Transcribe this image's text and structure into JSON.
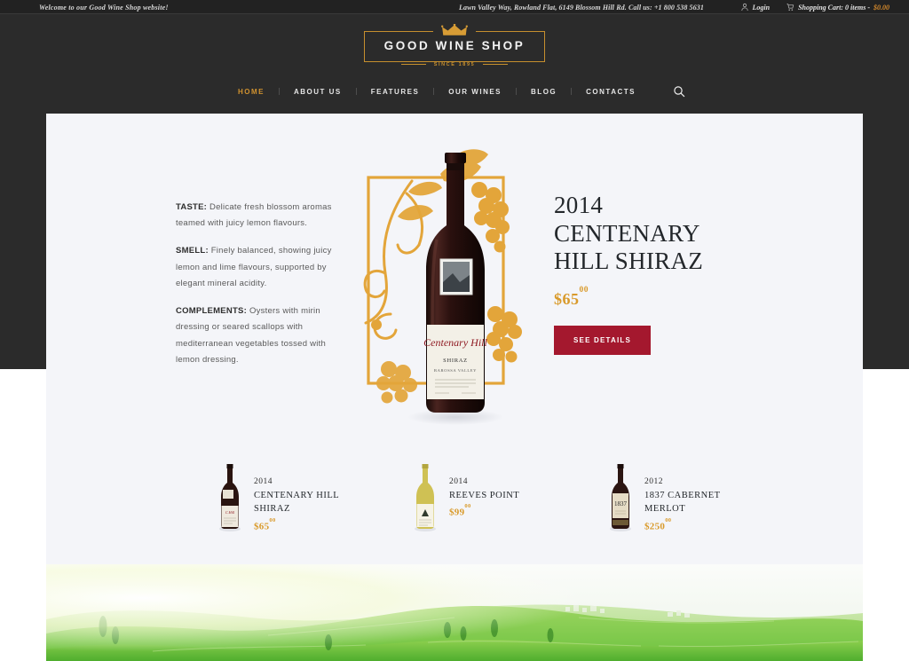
{
  "topbar": {
    "welcome": "Welcome to our Good Wine Shop website!",
    "contact": "Lawn Valley Way, Rowland Flat, 6149 Blossom Hill Rd. Call us: +1 800 538 5631",
    "login_label": "Login",
    "cart_label": "Shopping Cart: 0 items -",
    "cart_amount": "$0.00"
  },
  "logo": {
    "name": "GOOD WINE SHOP",
    "since": "SINCE 1895"
  },
  "nav": {
    "items": [
      {
        "label": "HOME",
        "active": true
      },
      {
        "label": "ABOUT US",
        "active": false
      },
      {
        "label": "FEATURES",
        "active": false
      },
      {
        "label": "OUR WINES",
        "active": false
      },
      {
        "label": "BLOG",
        "active": false
      },
      {
        "label": "CONTACTS",
        "active": false
      }
    ]
  },
  "hero": {
    "description": {
      "taste_label": "TASTE:",
      "taste_text": " Delicate fresh blossom aromas teamed with juicy lemon flavours.",
      "smell_label": "SMELL:",
      "smell_text": " Finely balanced, showing juicy lemon and lime flavours, supported by elegant mineral acidity.",
      "complements_label": "COMPLEMENTS:",
      "complements_text": " Oysters with mirin dressing or seared scallops with mediterranean vegetables tossed with lemon dressing."
    },
    "year": "2014",
    "title_line1": "CENTENARY",
    "title_line2": "HILL SHIRAZ",
    "price_main": "$65",
    "price_cents": "00",
    "cta_label": "SEE DETAILS",
    "bottle_label_script": "Centenary Hill",
    "bottle_label_variety": "SHIRAZ",
    "bottle_label_region": "BAROSSA VALLEY"
  },
  "thumbnails": [
    {
      "year": "2014",
      "name_line1": "CENTENARY HILL",
      "name_line2": "SHIRAZ",
      "price_main": "$65",
      "price_cents": "00",
      "bottle_color": "#2a1410",
      "label_color": "#efe9de"
    },
    {
      "year": "2014",
      "name_line1": "REEVES POINT",
      "name_line2": "",
      "price_main": "$99",
      "price_cents": "00",
      "bottle_color": "#cfc154",
      "label_color": "#f6f3e6"
    },
    {
      "year": "2012",
      "name_line1": "1837 CABERNET",
      "name_line2": "MERLOT",
      "price_main": "$250",
      "price_cents": "00",
      "bottle_color": "#2b1512",
      "label_color": "#e6dcc6"
    }
  ],
  "colors": {
    "gold": "#d0922f",
    "dark": "#2b2b2b",
    "panel": "#f4f5f9",
    "accent_red": "#a4182e",
    "ornament_gold": "#e3a53a"
  }
}
